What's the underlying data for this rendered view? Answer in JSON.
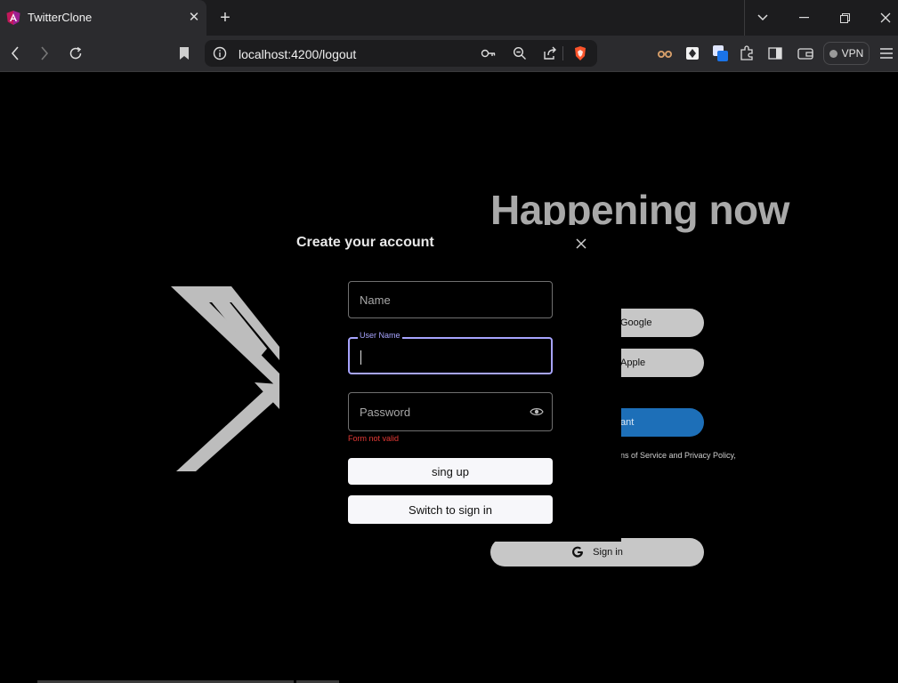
{
  "browser": {
    "tab_title": "TwitterClone",
    "tab_close_glyph": "✕",
    "new_tab_glyph": "+",
    "url": "localhost:4200/logout",
    "vpn_label": "VPN"
  },
  "page": {
    "headline": "Happening now",
    "google_button": "Google",
    "apple_button": "Apple",
    "create_account_button": "ant",
    "terms_text": "ns of Service and Privacy Policy,",
    "signin_button": "Sign in"
  },
  "modal": {
    "title": "Create your account",
    "name_placeholder": "Name",
    "username_label": "User Name",
    "password_placeholder": "Password",
    "error_text": "Form not valid",
    "signup_button": "sing up",
    "switch_button": "Switch to sign in"
  },
  "colors": {
    "focus_accent": "#a7a4ff",
    "error": "#e53935",
    "create_button": "#1d6fb8"
  }
}
